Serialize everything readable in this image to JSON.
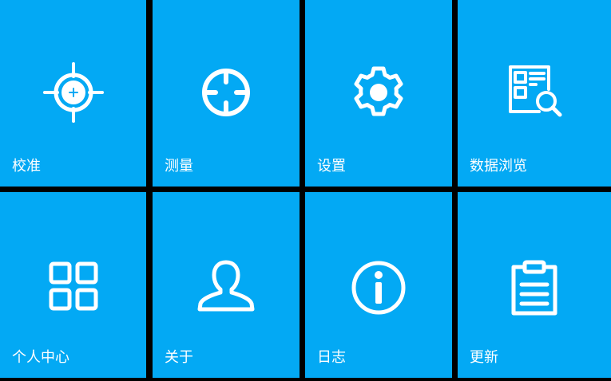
{
  "theme": {
    "tile_color": "#03a9f4",
    "gap_color": "#000000",
    "foreground": "#ffffff"
  },
  "tiles": [
    {
      "label": "校准",
      "icon": "calibrate-target-icon"
    },
    {
      "label": "测量",
      "icon": "crosshair-icon"
    },
    {
      "label": "设置",
      "icon": "gear-icon"
    },
    {
      "label": "数据浏览",
      "icon": "data-browse-icon"
    },
    {
      "label": "个人中心",
      "icon": "grid-icon"
    },
    {
      "label": "关于",
      "icon": "user-icon"
    },
    {
      "label": "日志",
      "icon": "info-icon"
    },
    {
      "label": "更新",
      "icon": "clipboard-icon"
    }
  ]
}
